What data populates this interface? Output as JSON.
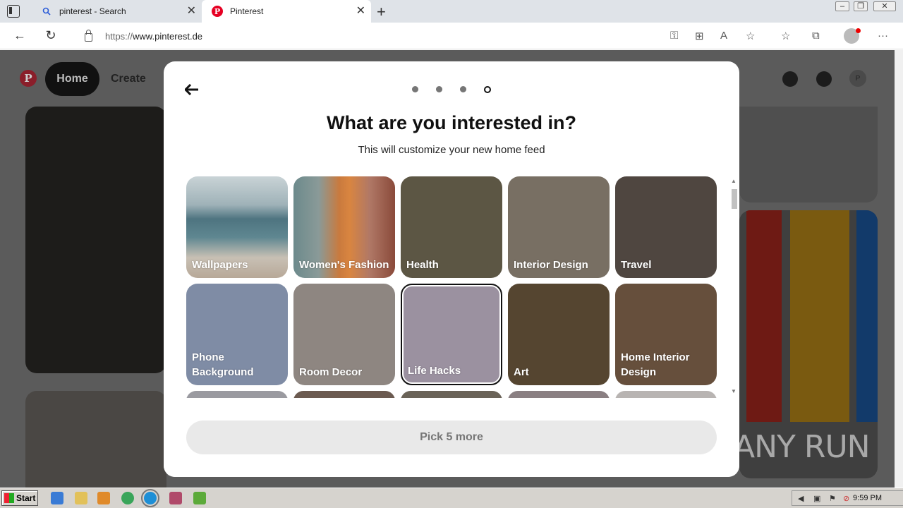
{
  "browser": {
    "tabs": [
      {
        "title": "pinterest - Search",
        "icon": "search-icon"
      },
      {
        "title": "Pinterest",
        "icon": "pinterest-icon"
      }
    ],
    "url_prefix": "https://",
    "url_host": "www.pinterest.de"
  },
  "page": {
    "nav_home": "Home",
    "nav_create": "Create",
    "profile_initial": "P"
  },
  "modal": {
    "title": "What are you interested in?",
    "subtitle": "This will customize your new home feed",
    "step_count": 4,
    "current_step": 4,
    "topics": [
      {
        "label": "Wallpapers",
        "color": "#6f8a91",
        "selected": false
      },
      {
        "label": "Women's Fashion",
        "color": "#b98a6e",
        "selected": false
      },
      {
        "label": "Health",
        "color": "#5c5644",
        "selected": false
      },
      {
        "label": "Interior Design",
        "color": "#786f63",
        "selected": false
      },
      {
        "label": "Travel",
        "color": "#4f4640",
        "selected": false
      },
      {
        "label": "Phone Background",
        "color": "#7f8ca5",
        "selected": false
      },
      {
        "label": "Room Decor",
        "color": "#8e8681",
        "selected": false
      },
      {
        "label": "Life Hacks",
        "color": "#9b91a0",
        "selected": true
      },
      {
        "label": "Art",
        "color": "#554530",
        "selected": false
      },
      {
        "label": "Home Interior Design",
        "color": "#664f3c",
        "selected": false
      }
    ],
    "next_row_colors": [
      "#9a9aa0",
      "#6b5a50",
      "#6a6358",
      "#8a7f82",
      "#b8b4b2"
    ],
    "button_label": "Pick 5 more"
  },
  "watermark": "ANY RUN",
  "taskbar": {
    "start_label": "Start",
    "clock": "9:59 PM"
  }
}
